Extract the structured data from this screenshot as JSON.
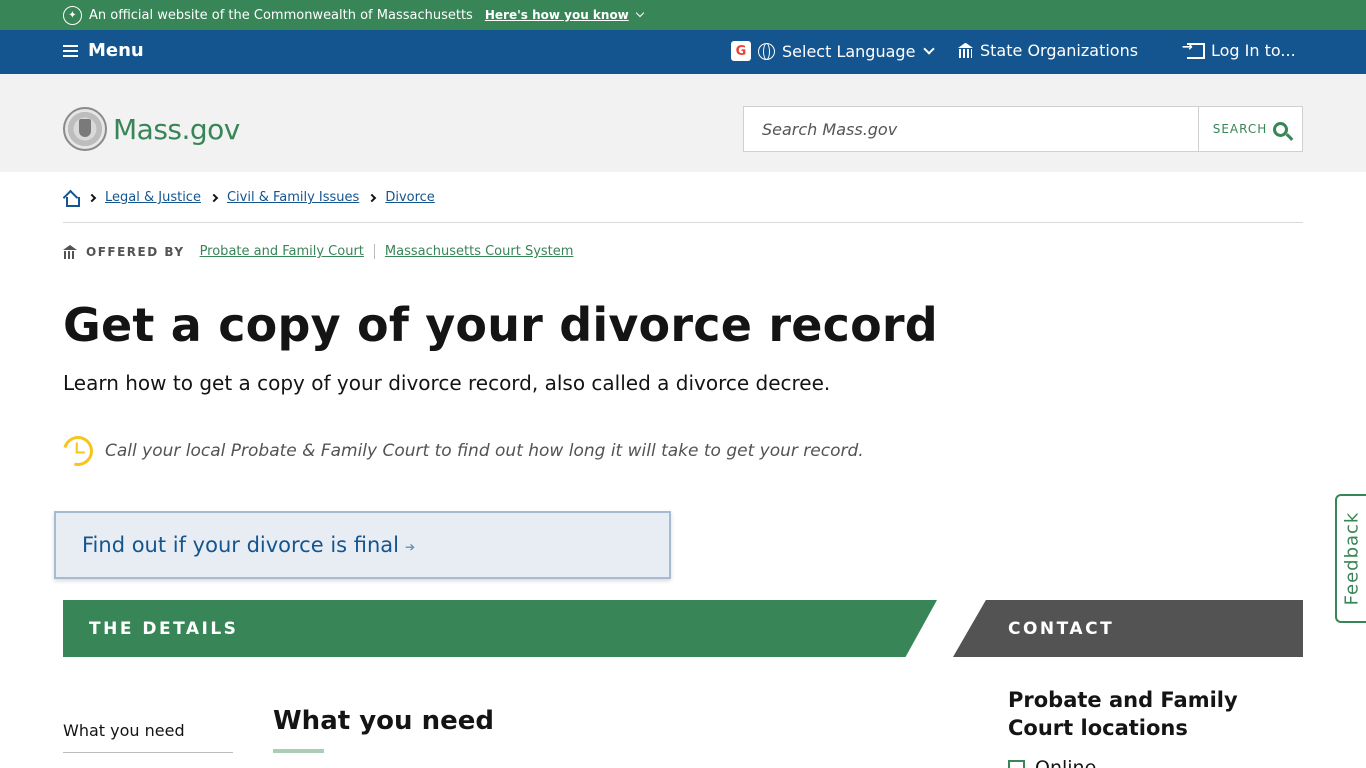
{
  "official_bar": {
    "text": "An official website of the Commonwealth of Massachusetts",
    "link": "Here's how you know"
  },
  "utility_nav": {
    "menu": "Menu",
    "language": "Select Language",
    "state_orgs": "State Organizations",
    "login": "Log In to..."
  },
  "header": {
    "logo_text": "Mass.gov",
    "search_placeholder": "Search Mass.gov",
    "search_button": "SEARCH"
  },
  "breadcrumb": {
    "items": [
      "Legal & Justice",
      "Civil & Family Issues",
      "Divorce"
    ]
  },
  "offered_by": {
    "label": "OFFERED BY",
    "orgs": [
      "Probate and Family Court",
      "Massachusetts Court System"
    ]
  },
  "page": {
    "title": "Get a copy of your divorce record",
    "subtitle": "Learn how to get a copy of your divorce record, also called a divorce decree.",
    "notice": "Call your local Probate & Family Court to find out how long it will take to get your record.",
    "cta": "Find out if your divorce is final"
  },
  "bands": {
    "details": "THE DETAILS",
    "contact": "CONTACT"
  },
  "toc": {
    "item": "What you need"
  },
  "section": {
    "heading": "What you need"
  },
  "contact": {
    "heading": "Probate and Family Court locations",
    "first_item": "Online"
  },
  "feedback": {
    "label": "Feedback"
  },
  "colors": {
    "green": "#388557",
    "blue": "#14558f",
    "dark_gray": "#535353",
    "header_gray": "#f2f2f2",
    "accent_yellow": "#f6c51b"
  }
}
